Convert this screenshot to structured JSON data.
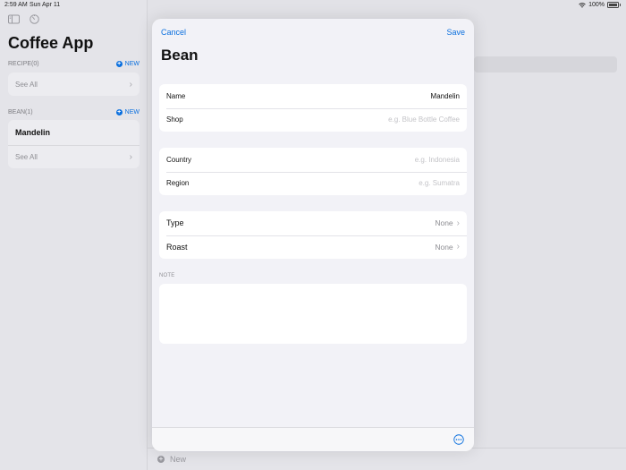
{
  "statusbar": {
    "time": "2:59 AM",
    "date": "Sun Apr 11",
    "battery": "100%"
  },
  "sidebar": {
    "title": "Coffee App",
    "recipe_section": {
      "header": "RECIPE(0)",
      "new_label": "NEW",
      "see_all": "See All"
    },
    "bean_section": {
      "header": "BEAN(1)",
      "new_label": "NEW",
      "items": [
        "Mandelin"
      ],
      "see_all": "See All"
    }
  },
  "bottom_bar": {
    "new_label": "New"
  },
  "sheet": {
    "cancel": "Cancel",
    "save": "Save",
    "title": "Bean",
    "fields": {
      "name": {
        "label": "Name",
        "value": "Mandelin"
      },
      "shop": {
        "label": "Shop",
        "placeholder": "e.g. Blue Bottle Coffee"
      },
      "country": {
        "label": "Country",
        "placeholder": "e.g. Indonesia"
      },
      "region": {
        "label": "Region",
        "placeholder": "e.g. Sumatra"
      },
      "type": {
        "label": "Type",
        "value": "None"
      },
      "roast": {
        "label": "Roast",
        "value": "None"
      }
    },
    "note_header": "NOTE",
    "note_value": ""
  },
  "colors": {
    "accent": "#0a6fde",
    "sheet_bg": "#f2f2f7",
    "dim_bg": "#e2e2e7"
  },
  "icons": [
    "sidebar-toggle-icon",
    "timer-icon",
    "wifi-icon",
    "battery-icon",
    "plus-circle-icon",
    "chevron-right-icon",
    "ellipsis-circle-icon"
  ]
}
